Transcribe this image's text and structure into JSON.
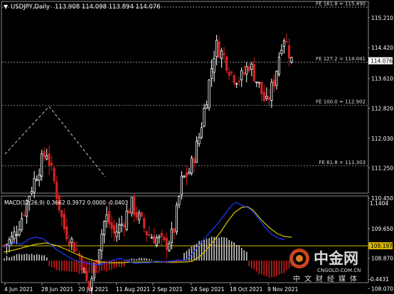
{
  "header": {
    "symbol": "USDJPY,Daily",
    "ohlc": "113.908 114.098 113.894 114.076"
  },
  "fib_levels": [
    {
      "label": "FE 161.8 = 115.490",
      "price": 115.49
    },
    {
      "label": "FE 127.2 = 114.041",
      "price": 114.041
    },
    {
      "label": "FE 100.0 = 112.902",
      "price": 112.902
    },
    {
      "label": "FE 61.8 = 111.303",
      "price": 111.303
    }
  ],
  "support_line": {
    "label": "109.197",
    "price": 109.197
  },
  "current_price": {
    "label": "114.076",
    "price": 114.076
  },
  "price_axis": [
    "115.210",
    "114.420",
    "113.610",
    "112.820",
    "112.030",
    "111.250",
    "110.450",
    "109.650",
    "108.870",
    "108.070"
  ],
  "macd": {
    "label": "MACD(12,26,9) 0.3662 0.3972 0.0000 -0.0403",
    "axis_top": "1.1404",
    "axis_bottom": "-0.4431"
  },
  "date_axis": [
    "4 Jun 2021",
    "28 Jun 2021",
    "20 Jul 2021",
    "11 Aug 2021",
    "2 Sep 2021",
    "24 Sep 2021",
    "18 Oct 2021",
    "9 Nov 2021"
  ],
  "watermark": {
    "brand": "中金网",
    "domain": "CNGOLD.COM.CN",
    "slogan": "中文财经媒体"
  },
  "colors": {
    "background": "#000000",
    "bull": "#ffffff",
    "bear": "#d22222",
    "fib": "#9e9e9e",
    "support": "#d6b600",
    "macd_hist_pos": "#c8c8c8",
    "macd_hist_neg": "#cc1e1e",
    "signal": "#d6c400",
    "macd_line": "#1d3cff"
  },
  "chart_data": {
    "type": "candlestick",
    "title": "USDJPY,Daily",
    "ylim": [
      107.9,
      115.9
    ],
    "close_path": [
      109.2,
      109.4,
      109.9,
      110.6,
      111.2,
      111.7,
      110.8,
      109.7,
      109.3,
      108.9,
      108.0,
      109.0,
      110.0,
      109.5,
      109.8,
      110.3,
      109.9,
      109.5,
      109.4,
      109.2,
      109.5,
      110.9,
      111.2,
      112.0,
      113.2,
      114.5,
      114.2,
      113.7,
      113.6,
      114.0,
      113.5,
      112.9,
      113.6,
      114.8,
      114.1
    ]
  }
}
